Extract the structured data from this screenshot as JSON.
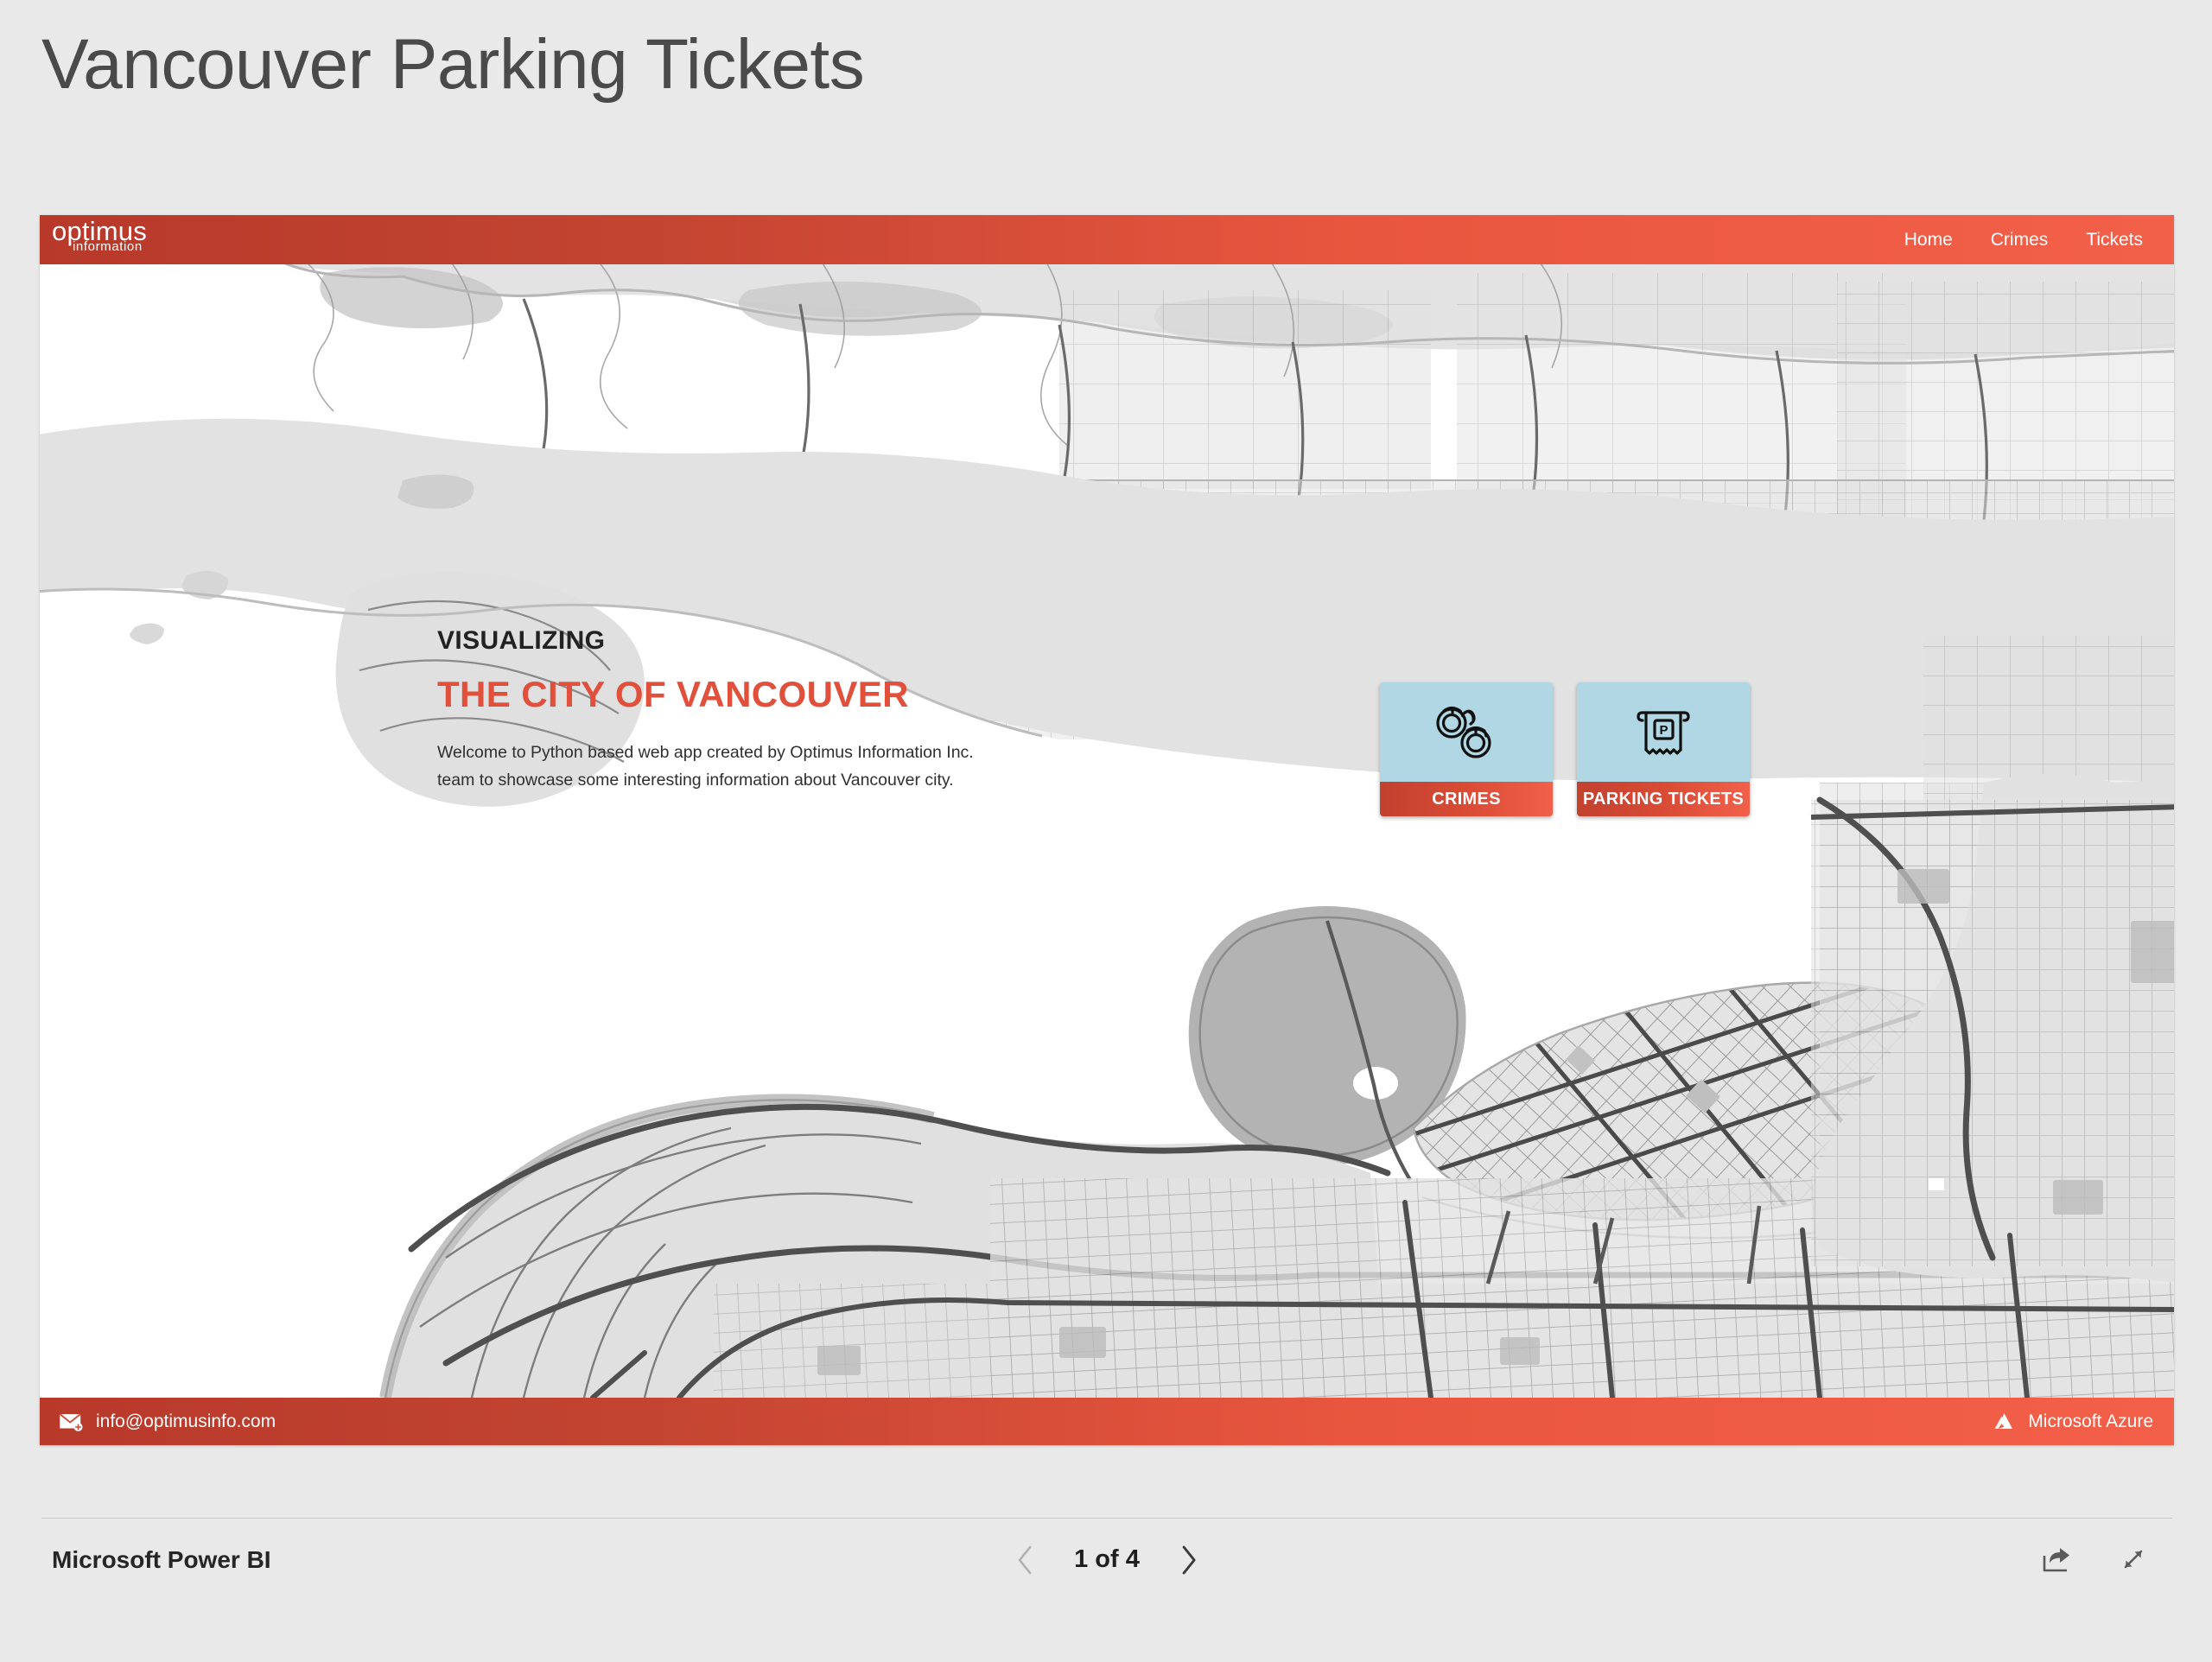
{
  "page": {
    "title": "Vancouver Parking Tickets",
    "background_color": "#e9e9e9"
  },
  "app": {
    "brand": {
      "primary": "optimus",
      "secondary": "information"
    },
    "accent_color": "#e0503a",
    "nav": [
      {
        "label": "Home",
        "name": "nav-home"
      },
      {
        "label": "Crimes",
        "name": "nav-crimes"
      },
      {
        "label": "Tickets",
        "name": "nav-tickets"
      }
    ],
    "hero": {
      "eyebrow": "VISUALIZING",
      "headline": "THE CITY OF VANCOUVER",
      "headline_color": "#e0503a",
      "body": "Welcome to Python based web app created by Optimus Information Inc. team to showcase some interesting information about Vancouver city."
    },
    "tiles": [
      {
        "label": "CRIMES",
        "icon": "handcuffs-icon",
        "tile_color": "#b0d7e3",
        "label_color": "#d94b35"
      },
      {
        "label": "PARKING TICKETS",
        "icon": "parking-ticket-icon",
        "tile_color": "#b0d7e3",
        "label_color": "#d94b35"
      }
    ],
    "footer": {
      "email": "info@optimusinfo.com",
      "email_icon": "envelope-icon",
      "cloud_label": "Microsoft Azure",
      "cloud_icon": "azure-logo-icon"
    },
    "map": {
      "style": "grayscale-street-map",
      "land_color": "#e0e0e0",
      "water_color": "#ffffff",
      "park_color": "#b9b9b9",
      "road_color": "#555555"
    }
  },
  "powerbi": {
    "brand": "Microsoft Power BI",
    "page_label": "1 of 4",
    "current_page": 1,
    "total_pages": 4,
    "prev_icon": "chevron-left-icon",
    "next_icon": "chevron-right-icon",
    "share_label": "",
    "share_icon": "share-icon",
    "fullscreen_label": "",
    "fullscreen_icon": "fullscreen-icon"
  }
}
